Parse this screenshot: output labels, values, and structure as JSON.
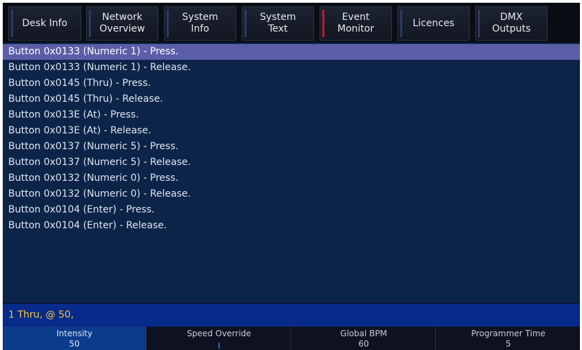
{
  "tabs": [
    {
      "label": "Desk Info",
      "active": false
    },
    {
      "label": "Network\nOverview",
      "active": false
    },
    {
      "label": "System\nInfo",
      "active": false
    },
    {
      "label": "System\nText",
      "active": false
    },
    {
      "label": "Event\nMonitor",
      "active": true
    },
    {
      "label": "Licences",
      "active": false
    },
    {
      "label": "DMX\nOutputs",
      "active": false
    }
  ],
  "events": [
    "Button 0x0133 (Numeric 1) - Press.",
    "Button 0x0133 (Numeric 1) - Release.",
    "Button 0x0145 (Thru) - Press.",
    "Button 0x0145 (Thru) - Release.",
    "Button 0x013E (At) - Press.",
    "Button 0x013E (At) - Release.",
    "Button 0x0137 (Numeric 5) - Press.",
    "Button 0x0137 (Numeric 5) - Release.",
    "Button 0x0132 (Numeric 0) - Press.",
    "Button 0x0132 (Numeric 0) - Release.",
    "Button 0x0104 (Enter) - Press.",
    "Button 0x0104 (Enter) - Release."
  ],
  "selected_event_index": 0,
  "command_line": "1 Thru, @ 50,",
  "encoders": [
    {
      "label": "Intensity",
      "value": "50",
      "active": true
    },
    {
      "label": "Speed Override",
      "value": "",
      "active": false
    },
    {
      "label": "Global BPM",
      "value": "60",
      "active": false
    },
    {
      "label": "Programmer Time",
      "value": "5",
      "active": false
    }
  ],
  "colors": {
    "background": "#0b1f3e",
    "selected_row": "#5b5ea6",
    "command_line_bg": "#082a8a",
    "command_line_text": "#f1c73a",
    "active_tab_accent": "#c8182a",
    "active_encoder": "#0b3c8c"
  }
}
